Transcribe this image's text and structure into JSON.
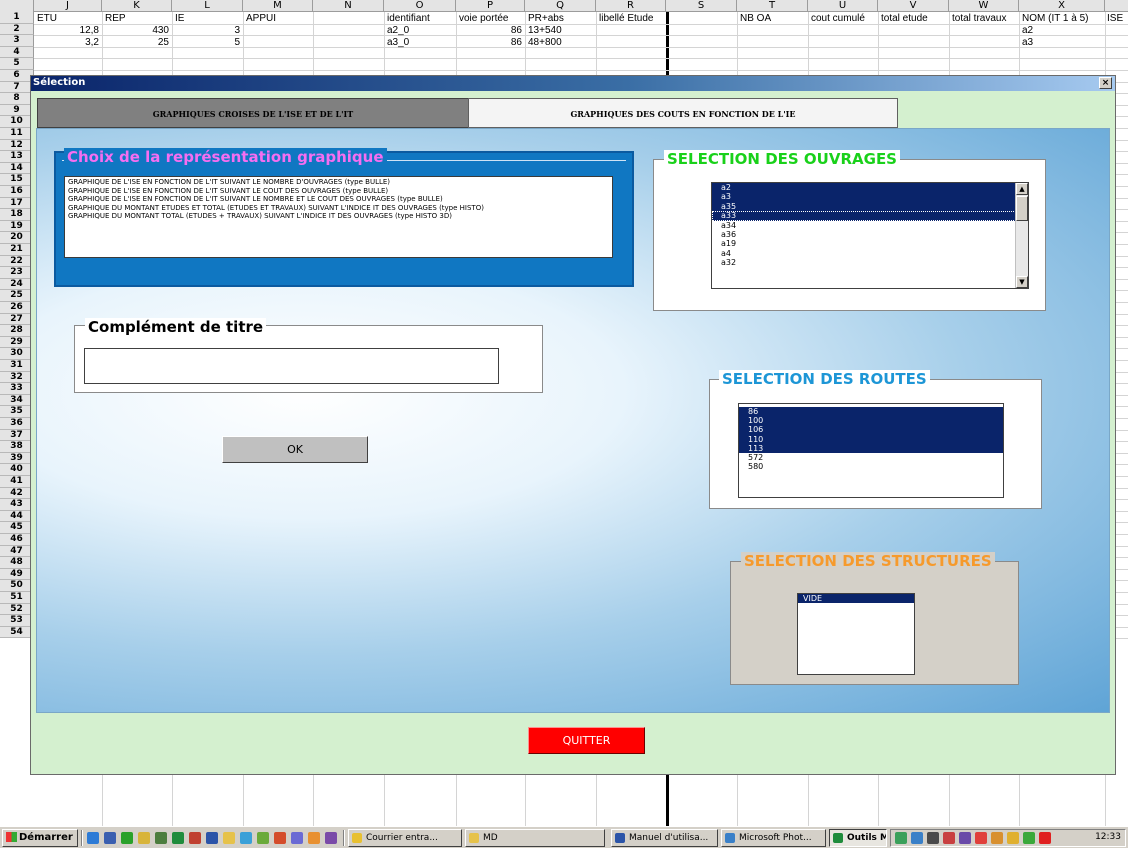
{
  "spreadsheet": {
    "columns": [
      "J",
      "K",
      "L",
      "M",
      "N",
      "O",
      "P",
      "Q",
      "R",
      "S",
      "T",
      "U",
      "V",
      "W",
      "X"
    ],
    "header_row": [
      "ETU",
      "REP",
      "IE",
      "APPUI",
      "",
      "identifiant",
      "voie portée",
      "PR+abs",
      "libellé Etude",
      "",
      "NB OA",
      "cout cumulé",
      "total etude",
      "total travaux",
      "NOM (IT 1 à 5)",
      "ISE"
    ],
    "row2": {
      "etu": "12,8",
      "rep": "430",
      "ie": "3",
      "identifiant": "a2_0",
      "voie": "86",
      "pr": "13+540",
      "nom": "a2"
    },
    "row3": {
      "etu": "3,2",
      "rep": "25",
      "ie": "5",
      "identifiant": "a3_0",
      "voie": "86",
      "pr": "48+800",
      "nom": "a3"
    },
    "row_numbers": [
      "1",
      "2",
      "3",
      "4",
      "5",
      "6",
      "7",
      "8",
      "9",
      "10",
      "11",
      "12",
      "13",
      "14",
      "15",
      "16",
      "17",
      "18",
      "19",
      "20",
      "21",
      "22",
      "23",
      "24",
      "25",
      "26",
      "27",
      "28",
      "29",
      "30",
      "31",
      "32",
      "33",
      "34",
      "35",
      "36",
      "37",
      "38",
      "39",
      "40",
      "41",
      "42",
      "43",
      "44",
      "45",
      "46",
      "47",
      "48",
      "49",
      "50",
      "51",
      "52",
      "53",
      "54"
    ]
  },
  "dialog": {
    "title": "Sélection",
    "close_label": "×",
    "tabs": [
      {
        "label": "GRAPHIQUES CROISES DE  L'ISE ET DE L'IT"
      },
      {
        "label": "GRAPHIQUES DES COUTS EN FONCTION DE L'IE"
      }
    ],
    "choix": {
      "title": "Choix de la représentation graphique",
      "items": [
        "GRAPHIQUE DE L'ISE EN FONCTION DE L'IT SUIVANT LE NOMBRE D'OUVRAGES (type BULLE)",
        "GRAPHIQUE DE L'ISE EN FONCTION DE L'IT SUIVANT LE COUT DES OUVRAGES (type BULLE)",
        "GRAPHIQUE DE L'ISE EN FONCTION DE L'IT SUIVANT LE NOMBRE ET LE COUT DES OUVRAGES (type BULLE)",
        "GRAPHIQUE DU MONTANT ETUDES ET TOTAL (ETUDES ET TRAVAUX) SUIVANT L'INDICE IT DES OUVRAGES (type HISTO)",
        "GRAPHIQUE DU MONTANT TOTAL (ETUDES + TRAVAUX) SUIVANT L'INDICE IT DES OUVRAGES (type HISTO 3D)"
      ]
    },
    "complement": {
      "title": "Complément de titre",
      "value": ""
    },
    "ok_label": "OK",
    "ouvrages": {
      "title": "SELECTION DES OUVRAGES",
      "items": [
        {
          "label": "a2",
          "selected": true
        },
        {
          "label": "a3",
          "selected": true
        },
        {
          "label": "a35",
          "selected": true
        },
        {
          "label": "a33",
          "selected": true
        },
        {
          "label": "a34",
          "selected": false
        },
        {
          "label": "a36",
          "selected": false
        },
        {
          "label": "a19",
          "selected": false
        },
        {
          "label": "a4",
          "selected": false
        },
        {
          "label": "a32",
          "selected": false
        }
      ]
    },
    "routes": {
      "title": "SELECTION DES ROUTES",
      "items": [
        {
          "label": "86",
          "selected": true
        },
        {
          "label": "100",
          "selected": true
        },
        {
          "label": "106",
          "selected": true
        },
        {
          "label": "110",
          "selected": true
        },
        {
          "label": "113",
          "selected": true
        },
        {
          "label": "572",
          "selected": false
        },
        {
          "label": "580",
          "selected": false
        }
      ]
    },
    "structures": {
      "title": "SELECTION DES STRUCTURES",
      "items": [
        {
          "label": "VIDE",
          "selected": true
        }
      ]
    },
    "quitter_label": "QUITTER"
  },
  "taskbar": {
    "start_label": "Démarrer",
    "tasks": [
      {
        "label": "Courrier entra...",
        "active": false
      },
      {
        "label": "MD",
        "active": false
      },
      {
        "label": "Manuel d'utilisa...",
        "active": false
      },
      {
        "label": "Microsoft Phot...",
        "active": false
      },
      {
        "label": "Outils MD_ve...",
        "active": true
      }
    ],
    "clock": "12:33"
  }
}
